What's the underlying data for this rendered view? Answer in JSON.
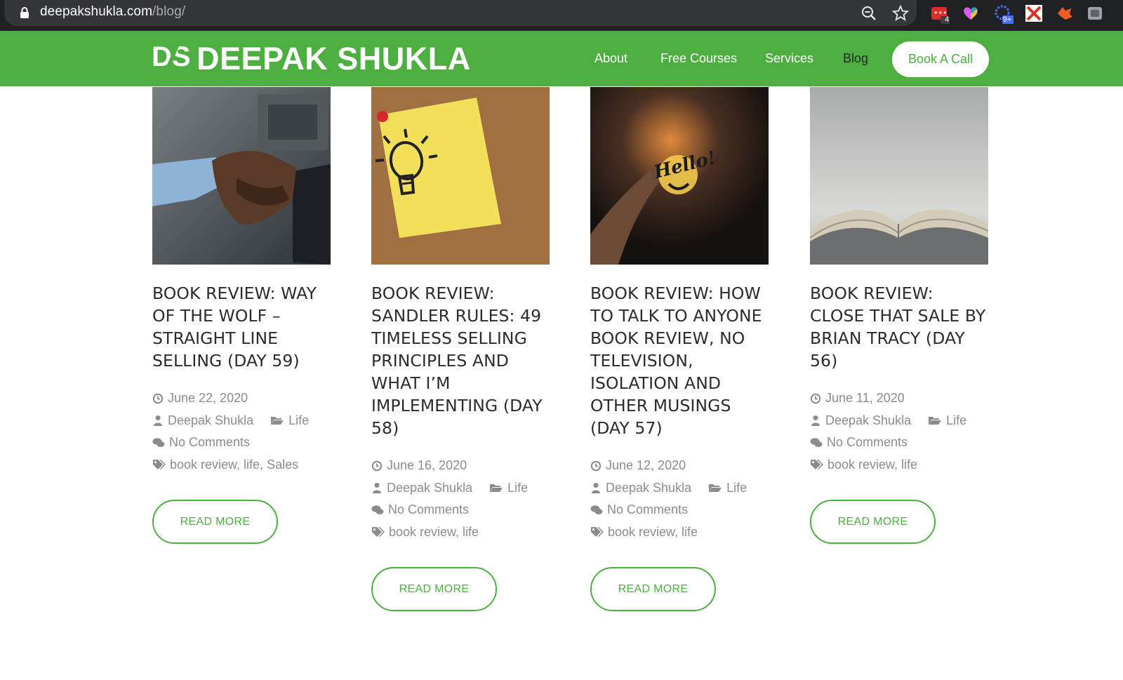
{
  "browser": {
    "url_domain": "deepakshukla.com",
    "url_path": "/blog/",
    "extension_badges": [
      "4",
      "9+"
    ],
    "icons": [
      "lock-icon",
      "zoom-icon",
      "star-icon",
      "extension-todo-icon",
      "extension-heart-icon",
      "extension-spark-icon",
      "extension-x-icon",
      "extension-fox-icon",
      "profile-icon"
    ]
  },
  "site": {
    "logo_mark": "DS",
    "logo_text": "DEEPAK SHUKLA",
    "brand_color": "#4caf3f",
    "nav": [
      {
        "label": "About"
      },
      {
        "label": "Free Courses"
      },
      {
        "label": "Services"
      },
      {
        "label": "Blog"
      }
    ],
    "cta_label": "Book A Call"
  },
  "posts": [
    {
      "title": "BOOK REVIEW: WAY OF THE WOLF – STRAIGHT LINE SELLING (DAY 59)",
      "date": "June 22, 2020",
      "author": "Deepak Shukla",
      "category": "Life",
      "comments": "No Comments",
      "tags": "book review, life, Sales",
      "read_more": "READ MORE",
      "image": "handshake"
    },
    {
      "title": "BOOK REVIEW: SANDLER RULES: 49 TIMELESS SELLING PRINCIPLES AND WHAT I’M IMPLEMENTING (DAY 58)",
      "date": "June 16, 2020",
      "author": "Deepak Shukla",
      "category": "Life",
      "comments": "No Comments",
      "tags": "book review, life",
      "read_more": "READ MORE",
      "image": "lightbulb-note"
    },
    {
      "title": "BOOK REVIEW: HOW TO TALK TO ANYONE BOOK REVIEW, NO TELEVISION, ISOLATION AND OTHER MUSINGS (DAY 57)",
      "date": "June 12, 2020",
      "author": "Deepak Shukla",
      "category": "Life",
      "comments": "No Comments",
      "tags": "book review, life",
      "read_more": "READ MORE",
      "image": "hello-sign",
      "image_text": "Hello!"
    },
    {
      "title": "BOOK REVIEW: CLOSE THAT SALE BY BRIAN TRACY (DAY 56)",
      "date": "June 11, 2020",
      "author": "Deepak Shukla",
      "category": "Life",
      "comments": "No Comments",
      "tags": "book review, life",
      "read_more": "READ MORE",
      "image": "open-book"
    }
  ]
}
